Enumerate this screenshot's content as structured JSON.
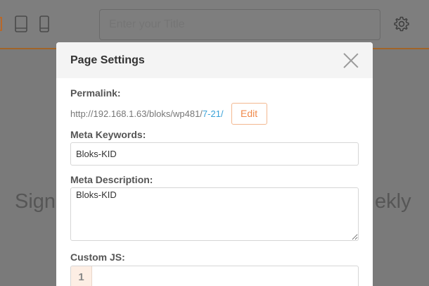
{
  "editor": {
    "title_placeholder": "Enter your Title",
    "background_text_left": "Sign",
    "background_text_right": "ekly",
    "icons": [
      "tablet-icon",
      "mobile-icon",
      "gear-icon"
    ]
  },
  "modal": {
    "title": "Page Settings",
    "permalink": {
      "label": "Permalink:",
      "base": "http://192.168.1.63/bloks/wp481/",
      "slug": "7-21/",
      "edit_label": "Edit"
    },
    "meta_keywords": {
      "label": "Meta Keywords:",
      "value": "Bloks-KID"
    },
    "meta_description": {
      "label": "Meta Description:",
      "value": "Bloks-KID"
    },
    "custom_js": {
      "label": "Custom JS:",
      "line_number": "1"
    }
  },
  "colors": {
    "accent": "#f08a4b",
    "link": "#3aa2d8",
    "overlay": "#7a7a7a"
  }
}
